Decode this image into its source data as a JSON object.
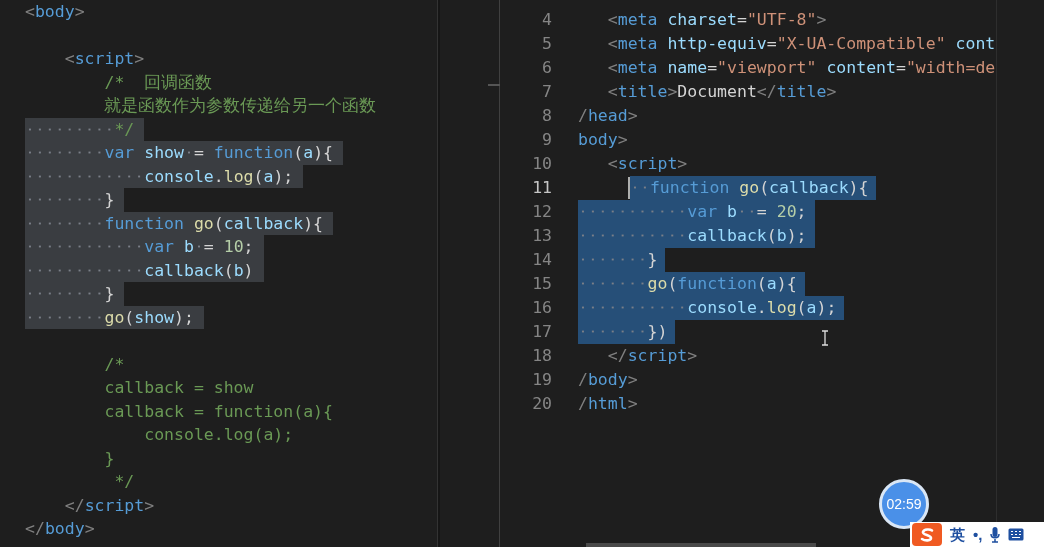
{
  "left_editor": {
    "lines": [
      {
        "selected": false,
        "segments": [
          {
            "kind": "punct",
            "text": "<"
          },
          {
            "kind": "tag",
            "text": "body"
          },
          {
            "kind": "punct",
            "text": ">"
          }
        ]
      },
      {
        "blank": true
      },
      {
        "selected": false,
        "segments": [
          {
            "kind": "punct",
            "text": "    <"
          },
          {
            "kind": "tag",
            "text": "script"
          },
          {
            "kind": "punct",
            "text": ">"
          }
        ]
      },
      {
        "selected": false,
        "segments": [
          {
            "kind": "comment",
            "text": "        /*  回调函数"
          }
        ]
      },
      {
        "selected": false,
        "segments": [
          {
            "kind": "comment",
            "text": "        就是函数作为参数传递给另一个函数"
          }
        ]
      },
      {
        "selected": true,
        "segments": [
          {
            "kind": "comment",
            "text": "         */"
          }
        ]
      },
      {
        "selected": true,
        "segments": [
          {
            "kind": "keyword",
            "text": "        var "
          },
          {
            "kind": "variable",
            "text": "show"
          },
          {
            "kind": "plain",
            "text": " = "
          },
          {
            "kind": "keyword",
            "text": "function"
          },
          {
            "kind": "plain",
            "text": "("
          },
          {
            "kind": "variable",
            "text": "a"
          },
          {
            "kind": "plain",
            "text": "){"
          }
        ]
      },
      {
        "selected": true,
        "segments": [
          {
            "kind": "variable",
            "text": "            console"
          },
          {
            "kind": "plain",
            "text": "."
          },
          {
            "kind": "function",
            "text": "log"
          },
          {
            "kind": "plain",
            "text": "("
          },
          {
            "kind": "variable",
            "text": "a"
          },
          {
            "kind": "plain",
            "text": ");"
          }
        ]
      },
      {
        "selected": true,
        "segments": [
          {
            "kind": "plain",
            "text": "        }"
          }
        ]
      },
      {
        "selected": true,
        "segments": [
          {
            "kind": "keyword",
            "text": "        function "
          },
          {
            "kind": "function",
            "text": "go"
          },
          {
            "kind": "plain",
            "text": "("
          },
          {
            "kind": "variable",
            "text": "callback"
          },
          {
            "kind": "plain",
            "text": "){"
          }
        ]
      },
      {
        "selected": true,
        "segments": [
          {
            "kind": "keyword",
            "text": "            var "
          },
          {
            "kind": "variable",
            "text": "b"
          },
          {
            "kind": "plain",
            "text": " = "
          },
          {
            "kind": "number",
            "text": "10"
          },
          {
            "kind": "plain",
            "text": ";"
          }
        ]
      },
      {
        "selected": true,
        "segments": [
          {
            "kind": "variable",
            "text": "            callback"
          },
          {
            "kind": "plain",
            "text": "("
          },
          {
            "kind": "variable",
            "text": "b"
          },
          {
            "kind": "plain",
            "text": ")"
          }
        ]
      },
      {
        "selected": true,
        "segments": [
          {
            "kind": "plain",
            "text": "        }"
          }
        ]
      },
      {
        "selected": true,
        "segments": [
          {
            "kind": "function",
            "text": "        go"
          },
          {
            "kind": "plain",
            "text": "("
          },
          {
            "kind": "variable",
            "text": "show"
          },
          {
            "kind": "plain",
            "text": ");"
          }
        ]
      },
      {
        "blank": true
      },
      {
        "selected": false,
        "segments": [
          {
            "kind": "comment",
            "text": "        /*"
          }
        ]
      },
      {
        "selected": false,
        "segments": [
          {
            "kind": "comment",
            "text": "        callback = show"
          }
        ]
      },
      {
        "selected": false,
        "segments": [
          {
            "kind": "comment",
            "text": "        callback = function(a){"
          }
        ]
      },
      {
        "selected": false,
        "segments": [
          {
            "kind": "comment",
            "text": "            console.log(a);"
          }
        ]
      },
      {
        "selected": false,
        "segments": [
          {
            "kind": "comment",
            "text": "        }"
          }
        ]
      },
      {
        "selected": false,
        "segments": [
          {
            "kind": "comment",
            "text": "         */"
          }
        ]
      },
      {
        "selected": false,
        "segments": [
          {
            "kind": "punct",
            "text": "    </"
          },
          {
            "kind": "tag",
            "text": "script"
          },
          {
            "kind": "punct",
            "text": ">"
          }
        ]
      },
      {
        "selected": false,
        "segments": [
          {
            "kind": "punct",
            "text": "</"
          },
          {
            "kind": "tag",
            "text": "body"
          },
          {
            "kind": "punct",
            "text": ">"
          }
        ]
      }
    ]
  },
  "right_editor": {
    "lines": [
      {
        "number": "4",
        "selected": false,
        "current": false,
        "segments": [
          {
            "kind": "punct",
            "text": "   <"
          },
          {
            "kind": "tag",
            "text": "meta "
          },
          {
            "kind": "attribute",
            "text": "charset"
          },
          {
            "kind": "plain",
            "text": "="
          },
          {
            "kind": "string",
            "text": "\"UTF-8\""
          },
          {
            "kind": "punct",
            "text": ">"
          }
        ]
      },
      {
        "number": "5",
        "selected": false,
        "current": false,
        "segments": [
          {
            "kind": "punct",
            "text": "   <"
          },
          {
            "kind": "tag",
            "text": "meta "
          },
          {
            "kind": "attribute",
            "text": "http-equiv"
          },
          {
            "kind": "plain",
            "text": "="
          },
          {
            "kind": "string",
            "text": "\"X-UA-Compatible\" "
          },
          {
            "kind": "attribute",
            "text": "cont"
          }
        ]
      },
      {
        "number": "6",
        "selected": false,
        "current": false,
        "segments": [
          {
            "kind": "punct",
            "text": "   <"
          },
          {
            "kind": "tag",
            "text": "meta "
          },
          {
            "kind": "attribute",
            "text": "name"
          },
          {
            "kind": "plain",
            "text": "="
          },
          {
            "kind": "string",
            "text": "\"viewport\" "
          },
          {
            "kind": "attribute",
            "text": "content"
          },
          {
            "kind": "plain",
            "text": "="
          },
          {
            "kind": "string",
            "text": "\"width=de"
          }
        ]
      },
      {
        "number": "7",
        "selected": false,
        "current": false,
        "segments": [
          {
            "kind": "punct",
            "text": "   <"
          },
          {
            "kind": "tag",
            "text": "title"
          },
          {
            "kind": "punct",
            "text": ">"
          },
          {
            "kind": "plain",
            "text": "Document"
          },
          {
            "kind": "punct",
            "text": "</"
          },
          {
            "kind": "tag",
            "text": "title"
          },
          {
            "kind": "punct",
            "text": ">"
          }
        ]
      },
      {
        "number": "8",
        "selected": false,
        "current": false,
        "segments": [
          {
            "kind": "punct",
            "text": "/"
          },
          {
            "kind": "tag",
            "text": "head"
          },
          {
            "kind": "punct",
            "text": ">"
          }
        ]
      },
      {
        "number": "9",
        "selected": false,
        "current": false,
        "segments": [
          {
            "kind": "tag",
            "text": "body"
          },
          {
            "kind": "punct",
            "text": ">"
          }
        ]
      },
      {
        "number": "10",
        "selected": false,
        "current": false,
        "segments": [
          {
            "kind": "punct",
            "text": "   <"
          },
          {
            "kind": "tag",
            "text": "script"
          },
          {
            "kind": "punct",
            "text": ">"
          }
        ]
      },
      {
        "number": "11",
        "selected": true,
        "current": true,
        "segments": [
          {
            "kind": "keyword",
            "text": "  function "
          },
          {
            "kind": "function",
            "text": "go"
          },
          {
            "kind": "plain",
            "text": "("
          },
          {
            "kind": "variable",
            "text": "callback"
          },
          {
            "kind": "plain",
            "text": "){"
          }
        ]
      },
      {
        "number": "12",
        "selected": true,
        "current": false,
        "segments": [
          {
            "kind": "keyword",
            "text": "           var "
          },
          {
            "kind": "variable",
            "text": "b"
          },
          {
            "kind": "plain",
            "text": "  = "
          },
          {
            "kind": "number",
            "text": "20"
          },
          {
            "kind": "plain",
            "text": ";"
          }
        ]
      },
      {
        "number": "13",
        "selected": true,
        "current": false,
        "segments": [
          {
            "kind": "variable",
            "text": "           callback"
          },
          {
            "kind": "plain",
            "text": "("
          },
          {
            "kind": "variable",
            "text": "b"
          },
          {
            "kind": "plain",
            "text": ");"
          }
        ]
      },
      {
        "number": "14",
        "selected": true,
        "current": false,
        "segments": [
          {
            "kind": "plain",
            "text": "       }"
          }
        ]
      },
      {
        "number": "15",
        "selected": true,
        "current": false,
        "segments": [
          {
            "kind": "function",
            "text": "       go"
          },
          {
            "kind": "plain",
            "text": "("
          },
          {
            "kind": "keyword",
            "text": "function"
          },
          {
            "kind": "plain",
            "text": "("
          },
          {
            "kind": "variable",
            "text": "a"
          },
          {
            "kind": "plain",
            "text": "){"
          }
        ]
      },
      {
        "number": "16",
        "selected": true,
        "current": false,
        "segments": [
          {
            "kind": "variable",
            "text": "           console"
          },
          {
            "kind": "plain",
            "text": "."
          },
          {
            "kind": "function",
            "text": "log"
          },
          {
            "kind": "plain",
            "text": "("
          },
          {
            "kind": "variable",
            "text": "a"
          },
          {
            "kind": "plain",
            "text": ");"
          }
        ]
      },
      {
        "number": "17",
        "selected": true,
        "current": false,
        "segments": [
          {
            "kind": "plain",
            "text": "       })"
          }
        ]
      },
      {
        "number": "18",
        "selected": false,
        "current": false,
        "segments": [
          {
            "kind": "punct",
            "text": "   </"
          },
          {
            "kind": "tag",
            "text": "script"
          },
          {
            "kind": "punct",
            "text": ">"
          }
        ]
      },
      {
        "number": "19",
        "selected": false,
        "current": false,
        "segments": [
          {
            "kind": "punct",
            "text": "/"
          },
          {
            "kind": "tag",
            "text": "body"
          },
          {
            "kind": "punct",
            "text": ">"
          }
        ]
      },
      {
        "number": "20",
        "selected": false,
        "current": false,
        "segments": [
          {
            "kind": "punct",
            "text": "/"
          },
          {
            "kind": "tag",
            "text": "html"
          },
          {
            "kind": "punct",
            "text": ">"
          }
        ]
      }
    ]
  },
  "timer": {
    "text": "02:59"
  },
  "ime_toolbar": {
    "items": [
      {
        "kind": "text",
        "text": "英"
      },
      {
        "kind": "text",
        "text": "•,"
      }
    ]
  }
}
